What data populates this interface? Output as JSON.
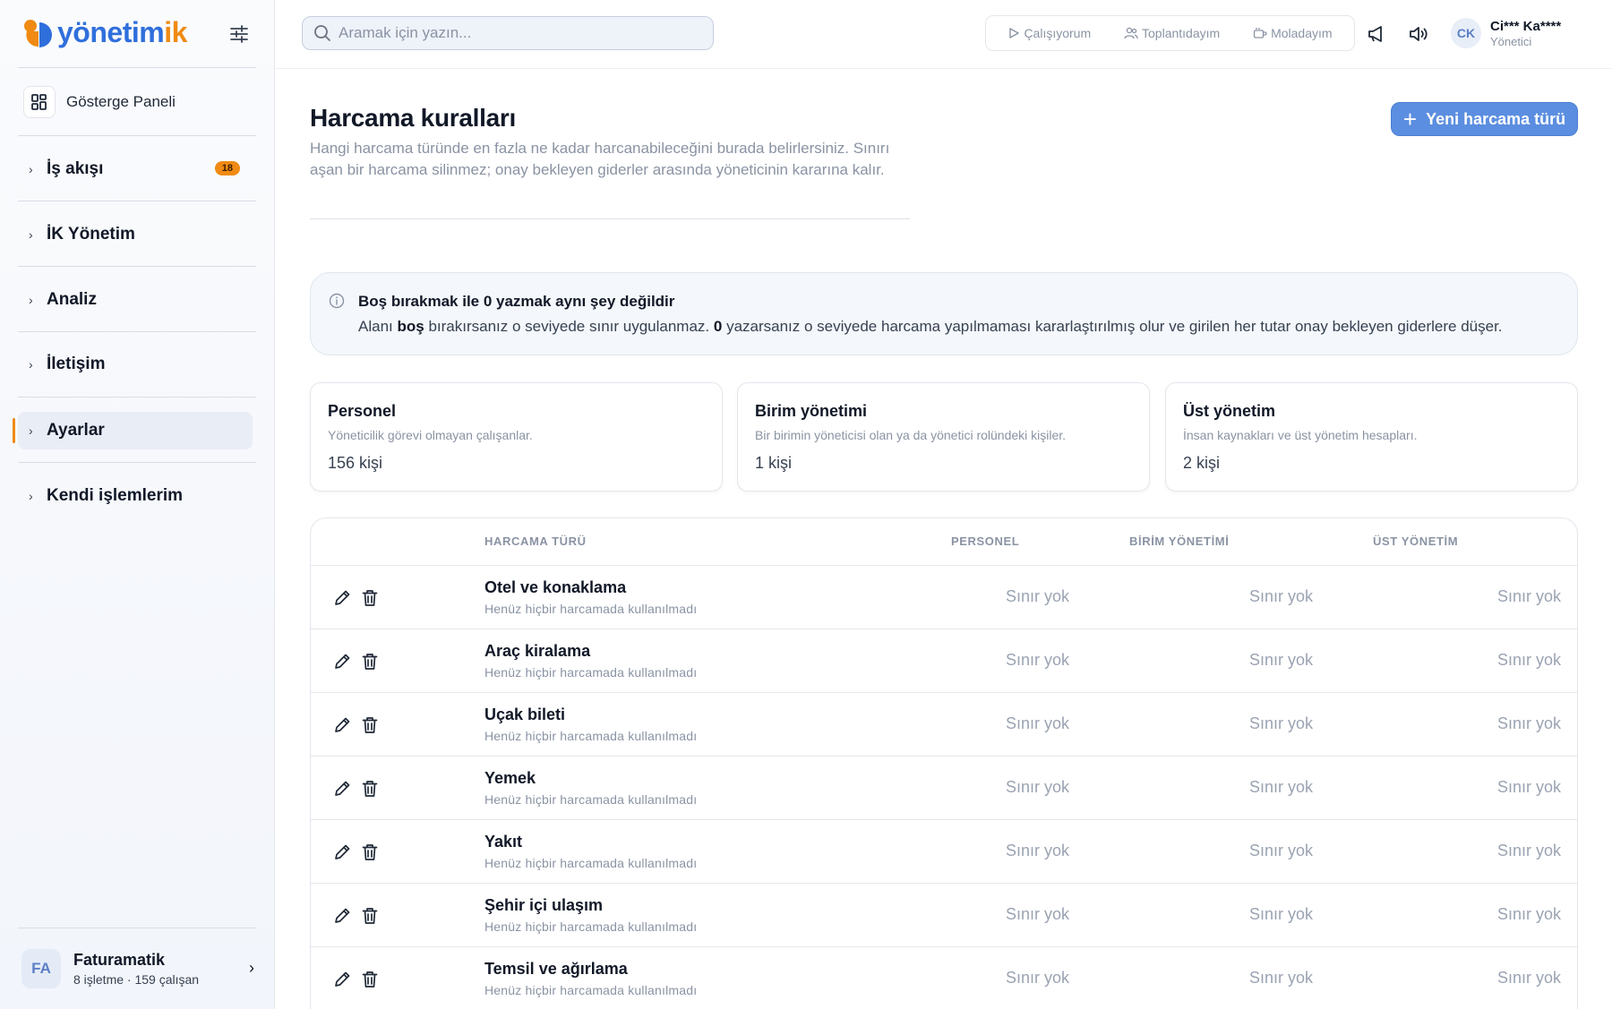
{
  "brand": {
    "name_main": "yönetim",
    "name_accent": "ik"
  },
  "sidebar": {
    "dashboard_label": "Gösterge Paneli",
    "items": [
      {
        "label": "İş akışı",
        "badge": "18"
      },
      {
        "label": "İK Yönetim"
      },
      {
        "label": "Analiz"
      },
      {
        "label": "İletişim"
      },
      {
        "label": "Ayarlar",
        "active": true
      },
      {
        "label": "Kendi işlemlerim"
      }
    ],
    "org": {
      "initials": "FA",
      "name": "Faturamatik",
      "sub": "8 işletme · 159 çalışan"
    }
  },
  "topbar": {
    "search_placeholder": "Aramak için yazın...",
    "statuses": [
      "Çalışıyorum",
      "Toplantıdayım",
      "Moladayım"
    ],
    "user": {
      "initials": "CK",
      "name": "Ci*** Ka****",
      "role": "Yönetici"
    }
  },
  "page": {
    "title": "Harcama kuralları",
    "description": "Hangi harcama türünde en fazla ne kadar harcanabileceğini burada belirlersiniz. Sınırı aşan bir harcama silinmez; onay bekleyen giderler arasında yöneticinin kararına kalır.",
    "new_button": "Yeni harcama türü"
  },
  "info": {
    "title": "Boş bırakmak ile 0 yazmak aynı şey değildir",
    "text_1": "Alanı ",
    "bold_1": "boş",
    "text_2": " bırakırsanız o seviyede sınır uygulanmaz. ",
    "bold_2": "0",
    "text_3": " yazarsanız o seviyede harcama yapılmaması kararlaştırılmış olur ve girilen her tutar onay bekleyen giderlere düşer."
  },
  "levels": [
    {
      "name": "Personel",
      "desc": "Yöneticilik görevi olmayan çalışanlar.",
      "count": "156 kişi"
    },
    {
      "name": "Birim yönetimi",
      "desc": "Bir birimin yöneticisi olan ya da yönetici rolündeki kişiler.",
      "count": "1 kişi"
    },
    {
      "name": "Üst yönetim",
      "desc": "İnsan kaynakları ve üst yönetim hesapları.",
      "count": "2 kişi"
    }
  ],
  "table": {
    "headers": {
      "type": "HARCAMA TÜRÜ",
      "personel": "PERSONEL",
      "birim": "BİRİM YÖNETİMİ",
      "ust": "ÜST YÖNETİM"
    },
    "rows": [
      {
        "name": "Otel ve konaklama",
        "sub": "Henüz hiçbir harcamada kullanılmadı",
        "personel": "Sınır yok",
        "birim": "Sınır yok",
        "ust": "Sınır yok"
      },
      {
        "name": "Araç kiralama",
        "sub": "Henüz hiçbir harcamada kullanılmadı",
        "personel": "Sınır yok",
        "birim": "Sınır yok",
        "ust": "Sınır yok"
      },
      {
        "name": "Uçak bileti",
        "sub": "Henüz hiçbir harcamada kullanılmadı",
        "personel": "Sınır yok",
        "birim": "Sınır yok",
        "ust": "Sınır yok"
      },
      {
        "name": "Yemek",
        "sub": "Henüz hiçbir harcamada kullanılmadı",
        "personel": "Sınır yok",
        "birim": "Sınır yok",
        "ust": "Sınır yok"
      },
      {
        "name": "Yakıt",
        "sub": "Henüz hiçbir harcamada kullanılmadı",
        "personel": "Sınır yok",
        "birim": "Sınır yok",
        "ust": "Sınır yok"
      },
      {
        "name": "Şehir içi ulaşım",
        "sub": "Henüz hiçbir harcamada kullanılmadı",
        "personel": "Sınır yok",
        "birim": "Sınır yok",
        "ust": "Sınır yok"
      },
      {
        "name": "Temsil ve ağırlama",
        "sub": "Henüz hiçbir harcamada kullanılmadı",
        "personel": "Sınır yok",
        "birim": "Sınır yok",
        "ust": "Sınır yok"
      }
    ]
  },
  "colors": {
    "brand_blue": "#2f6fdc",
    "brand_orange": "#f08a12",
    "primary_button": "#5b8ee0"
  },
  "icons": [
    "filter-sliders-icon",
    "dashboard-grid-icon",
    "search-icon",
    "play-icon",
    "users-icon",
    "coffee-icon",
    "megaphone-icon",
    "speaker-icon",
    "info-icon",
    "pencil-icon",
    "trash-icon",
    "plus-icon",
    "chevron-right-icon"
  ]
}
